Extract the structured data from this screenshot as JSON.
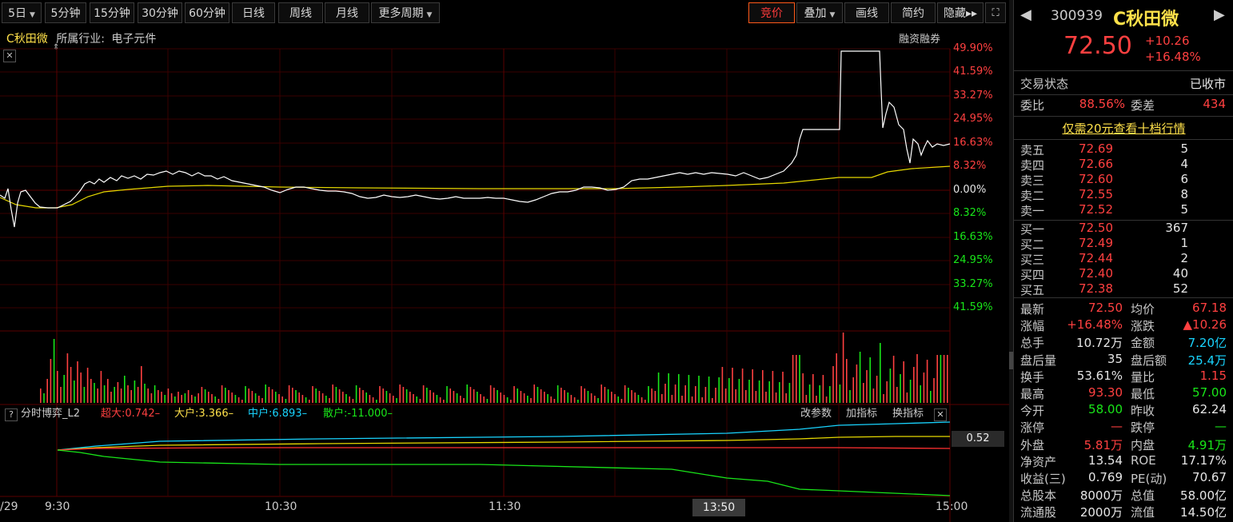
{
  "toolbar": {
    "periods": [
      "5日",
      "5分钟",
      "15分钟",
      "30分钟",
      "60分钟",
      "日线",
      "周线",
      "月线",
      "更多周期"
    ],
    "right_buttons": [
      "竞价",
      "叠加",
      "画线",
      "简约",
      "隐藏▸▸"
    ],
    "expand_icon": "expand-icon"
  },
  "chart_header": {
    "stock_name": "C秋田微",
    "industry_label": "所属行业:",
    "industry": "电子元件",
    "margin": "融资融券"
  },
  "right_axis_pct": [
    "49.90%",
    "41.59%",
    "33.27%",
    "24.95%",
    "16.63%",
    "8.32%",
    "0.00%",
    "8.32%",
    "16.63%",
    "24.95%",
    "33.27%",
    "41.59%"
  ],
  "indicator_bar": {
    "question": "?",
    "name": "分时博弈_L2",
    "super": "超大:0.742–",
    "big": "大户:3.366–",
    "mid": "中户:6.893–",
    "small": "散户:-11.000–",
    "btn_params": "改参数",
    "btn_add": "加指标",
    "btn_switch": "换指标",
    "value_box": "0.52"
  },
  "time_axis": {
    "labels": [
      "/29",
      "9:30",
      "10:30",
      "11:30",
      "13:50",
      "15:00"
    ]
  },
  "colors": {
    "up": "#ff4040",
    "down": "#19e619",
    "price_line": "#ffffff",
    "avg_line": "#e6d800",
    "cyan": "#19d4ff",
    "grid": "#3a0000"
  },
  "chart_data": {
    "type": "line",
    "title": "",
    "ylabel": "",
    "xlabel": "",
    "pct_ticks": [
      49.9,
      41.59,
      33.27,
      24.95,
      16.63,
      8.32,
      0.0,
      -8.32,
      -16.63,
      -24.95,
      -33.27,
      -41.59
    ],
    "x": [
      "9:30",
      "10:00",
      "10:30",
      "11:00",
      "11:30",
      "13:00",
      "13:30",
      "14:00",
      "14:30",
      "15:00"
    ],
    "series": [
      {
        "values": [
          -1.0,
          2.0,
          1.5,
          0.0,
          -1.0,
          -0.5,
          1.0,
          2.0,
          49.9,
          16.5
        ]
      },
      {
        "values": [
          -1.0,
          1.0,
          1.2,
          1.0,
          0.8,
          0.9,
          1.2,
          2.0,
          6.0,
          8.32
        ]
      }
    ],
    "ylim": [
      -41.59,
      49.9
    ]
  },
  "panel": {
    "code": "300939",
    "name": "C秋田微",
    "price": "72.50",
    "change": "+10.26",
    "change_pct": "+16.48%",
    "status_label": "交易状态",
    "status_value": "已收市",
    "weibi_label": "委比",
    "weibi_value": "88.56%",
    "weicha_label": "委差",
    "weicha_value": "434",
    "promo": "仅需20元查看十档行情",
    "asks": [
      {
        "label": "卖五",
        "price": "72.69",
        "vol": "5"
      },
      {
        "label": "卖四",
        "price": "72.66",
        "vol": "4"
      },
      {
        "label": "卖三",
        "price": "72.60",
        "vol": "6"
      },
      {
        "label": "卖二",
        "price": "72.55",
        "vol": "8"
      },
      {
        "label": "卖一",
        "price": "72.52",
        "vol": "5"
      }
    ],
    "bids": [
      {
        "label": "买一",
        "price": "72.50",
        "vol": "367"
      },
      {
        "label": "买二",
        "price": "72.49",
        "vol": "1"
      },
      {
        "label": "买三",
        "price": "72.44",
        "vol": "2"
      },
      {
        "label": "买四",
        "price": "72.40",
        "vol": "40"
      },
      {
        "label": "买五",
        "price": "72.38",
        "vol": "52"
      }
    ],
    "stats": [
      {
        "l1": "最新",
        "v1": "72.50",
        "c1": "red",
        "l2": "均价",
        "v2": "67.18",
        "c2": "red"
      },
      {
        "l1": "涨幅",
        "v1": "+16.48%",
        "c1": "red",
        "l2": "涨跌",
        "v2": "▲10.26",
        "c2": "red"
      },
      {
        "l1": "总手",
        "v1": "10.72万",
        "c1": "white",
        "l2": "金额",
        "v2": "7.20亿",
        "c2": "cyan"
      },
      {
        "l1": "盘后量",
        "v1": "35",
        "c1": "white",
        "l2": "盘后额",
        "v2": "25.4万",
        "c2": "cyan"
      },
      {
        "l1": "换手",
        "v1": "53.61%",
        "c1": "white",
        "l2": "量比",
        "v2": "1.15",
        "c2": "red"
      },
      {
        "l1": "最高",
        "v1": "93.30",
        "c1": "red",
        "l2": "最低",
        "v2": "57.00",
        "c2": "green"
      },
      {
        "l1": "今开",
        "v1": "58.00",
        "c1": "green",
        "l2": "昨收",
        "v2": "62.24",
        "c2": "white"
      },
      {
        "l1": "涨停",
        "v1": "—",
        "c1": "red",
        "l2": "跌停",
        "v2": "—",
        "c2": "green"
      },
      {
        "l1": "外盘",
        "v1": "5.81万",
        "c1": "red",
        "l2": "内盘",
        "v2": "4.91万",
        "c2": "green"
      },
      {
        "l1": "净资产",
        "v1": "13.54",
        "c1": "white",
        "l2": "ROE",
        "v2": "17.17%",
        "c2": "white"
      },
      {
        "l1": "收益(三)",
        "v1": "0.769",
        "c1": "white",
        "l2": "PE(动)",
        "v2": "70.67",
        "c2": "white"
      },
      {
        "l1": "总股本",
        "v1": "8000万",
        "c1": "white",
        "l2": "总值",
        "v2": "58.00亿",
        "c2": "white"
      },
      {
        "l1": "流通股",
        "v1": "2000万",
        "c1": "white",
        "l2": "流值",
        "v2": "14.50亿",
        "c2": "white"
      }
    ]
  }
}
